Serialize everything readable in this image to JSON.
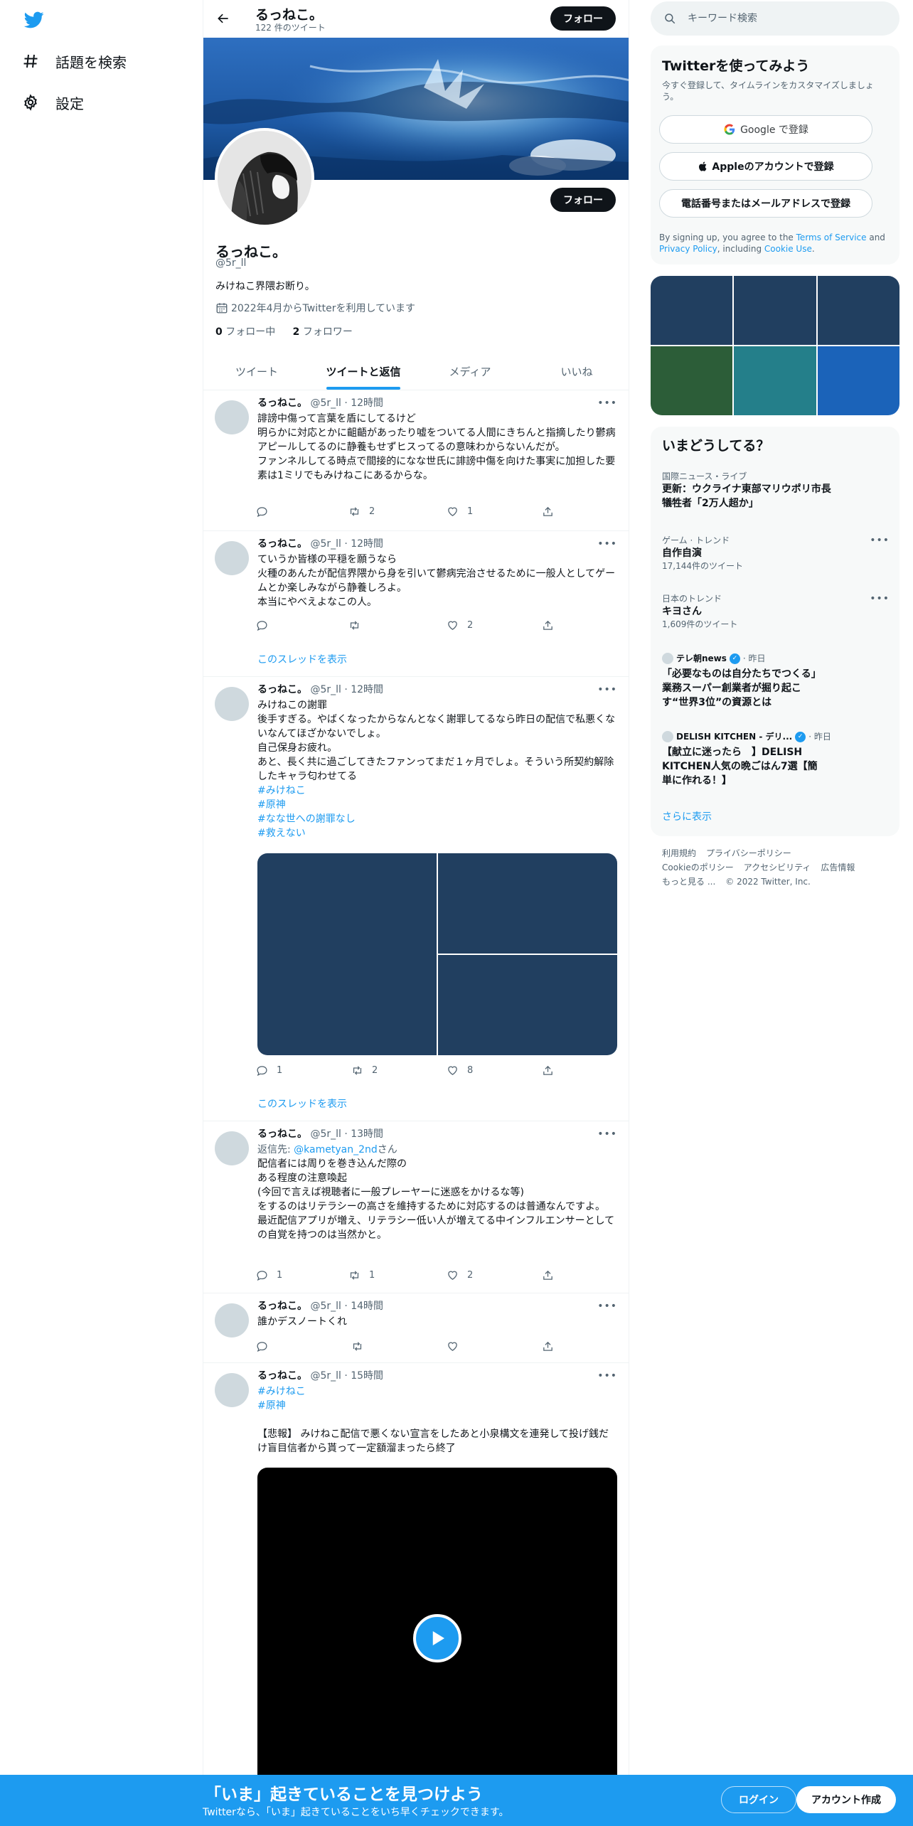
{
  "nav": {
    "explore_label": "話題を検索",
    "settings_label": "設定"
  },
  "header": {
    "name": "るっねこ。",
    "tweet_count": "122 件のツイート",
    "follow_label": "フォロー"
  },
  "profile": {
    "name": "るっねこ。",
    "handle": "@5r_ll",
    "bio": "みけねこ界隈お断り。",
    "joined": "2022年4月からTwitterを利用しています",
    "following_count": "0",
    "following_label": "フォロー中",
    "followers_count": "2",
    "followers_label": "フォロワー",
    "follow_label": "フォロー"
  },
  "tabs": [
    {
      "label": "ツイート"
    },
    {
      "label": "ツイートと返信"
    },
    {
      "label": "メディア"
    },
    {
      "label": "いいね"
    }
  ],
  "tweets": [
    {
      "name": "るっねこ。",
      "meta": "@5r_ll · 12時間",
      "lines": [
        "誹謗中傷って言葉を盾にしてるけど",
        "明らかに対応とかに齟齬があったり嘘をついてる人間にきちんと指摘したり鬱病アピールしてるのに静養もせずヒスってるの意味わからないんだが。",
        "ファンネルしてる時点で間接的になな世氏に誹謗中傷を向けた事実に加担した要素は1ミリでもみけねこにあるからな。"
      ],
      "reply": "",
      "retweet": "2",
      "like": "1"
    },
    {
      "name": "るっねこ。",
      "meta": "@5r_ll · 12時間",
      "lines": [
        "ていうか皆様の平穏を願うなら",
        "火種のあんたが配信界隈から身を引いて鬱病完治させるために一般人としてゲームとか楽しみながら静養しろよ。",
        "本当にやべえよなこの人。"
      ],
      "reply": "",
      "retweet": "",
      "like": "2",
      "thread": "このスレッドを表示"
    },
    {
      "name": "るっねこ。",
      "meta": "@5r_ll · 12時間",
      "lines": [
        "みけねこの謝罪",
        "後手すぎる。やばくなったからなんとなく謝罪してるなら昨日の配信で私悪くないなんてほざかないでしょ。",
        "自己保身お疲れ。",
        "あと、長く共に過ごしてきたファンってまだ１ヶ月でしょ。そういう所契約解除したキャラ匂わせてる"
      ],
      "hashtags": [
        "#みけねこ",
        "#原神",
        "#なな世への謝罪なし",
        "#救えない"
      ],
      "reply": "1",
      "retweet": "2",
      "like": "8",
      "thread": "このスレッドを表示"
    },
    {
      "name": "るっねこ。",
      "meta": "@5r_ll · 13時間",
      "reply_to_prefix": "返信先: ",
      "reply_to_user": "@kametyan_2nd",
      "reply_to_suffix": "さん",
      "lines": [
        "配信者には周りを巻き込んだ際の",
        "ある程度の注意喚起",
        "(今回で言えば視聴者に一般プレーヤーに迷惑をかけるな等)",
        "をするのはリテラシーの高さを維持するために対応するのは普通なんですよ。",
        "最近配信アプリが増え、リテラシー低い人が増えてる中インフルエンサーとしての自覚を持つのは当然かと。"
      ],
      "reply": "1",
      "retweet": "1",
      "like": "2"
    },
    {
      "name": "るっねこ。",
      "meta": "@5r_ll · 14時間",
      "lines": [
        "誰かデスノートくれ"
      ],
      "reply": "",
      "retweet": "",
      "like": ""
    },
    {
      "name": "るっねこ。",
      "meta": "@5r_ll · 15時間",
      "hashtags": [
        "#みけねこ",
        "#原神"
      ],
      "lines": [
        "【悲報】 みけねこ配信で悪くない宣言をしたあと小泉構文を連発して投げ銭だけ盲目信者から貰って一定額溜まったら終了"
      ]
    }
  ],
  "search": {
    "placeholder": "キーワード検索"
  },
  "signup": {
    "title": "Twitterを使ってみよう",
    "subtitle": "今すぐ登録して、タイムラインをカスタマイズしましょう。",
    "google": "Google で登録",
    "apple": "Appleのアカウントで登録",
    "phone": "電話番号またはメールアドレスで登録",
    "terms_prefix": "By signing up, you agree to the ",
    "terms_tos": "Terms of Service",
    "terms_and": " and ",
    "terms_privacy": "Privacy Policy",
    "terms_including": ", including ",
    "terms_cookie": "Cookie Use",
    "terms_end": "."
  },
  "colors": {
    "accent": "#1d9bf0",
    "photo_grid": [
      "#213f60",
      "#213f60",
      "#213f60",
      "#2c5d38",
      "#247f8a",
      "#1b63b9"
    ]
  },
  "trends": {
    "title": "いまどうしてる？",
    "items": [
      {
        "category": "国際ニュース・ライブ",
        "name": "更新：ウクライナ東部マリウポリ市長 犠牲者「2万人超か」"
      },
      {
        "category": "ゲーム · トレンド",
        "name": "自作自演",
        "count": "17,144件のツイート"
      },
      {
        "category": "日本のトレンド",
        "name": "キヨさん",
        "count": "1,609件のツイート"
      }
    ],
    "news": [
      {
        "source": "テレ朝news",
        "time": "· 昨日",
        "headline": "「必要なものは自分たちでつくる」　業務スーパー創業者が掘り起こす“世界3位”の資源とは"
      },
      {
        "source": "DELISH KITCHEN - デリ...",
        "time": "· 昨日",
        "headline": "【献立に迷ったら　】DELISH KITCHEN人気の晩ごはん7選【簡単に作れる！】"
      }
    ],
    "show_more": "さらに表示"
  },
  "footer": {
    "links": [
      "利用規約",
      "プライバシーポリシー",
      "Cookieのポリシー",
      "アクセシビリティ",
      "広告情報",
      "もっと見る ..."
    ],
    "copyright": "© 2022 Twitter, Inc."
  },
  "bottom_bar": {
    "title": "「いま」起きていることを見つけよう",
    "subtitle": "Twitterなら、「いま」起きていることをいち早くチェックできます。",
    "login": "ログイン",
    "signup": "アカウント作成"
  }
}
